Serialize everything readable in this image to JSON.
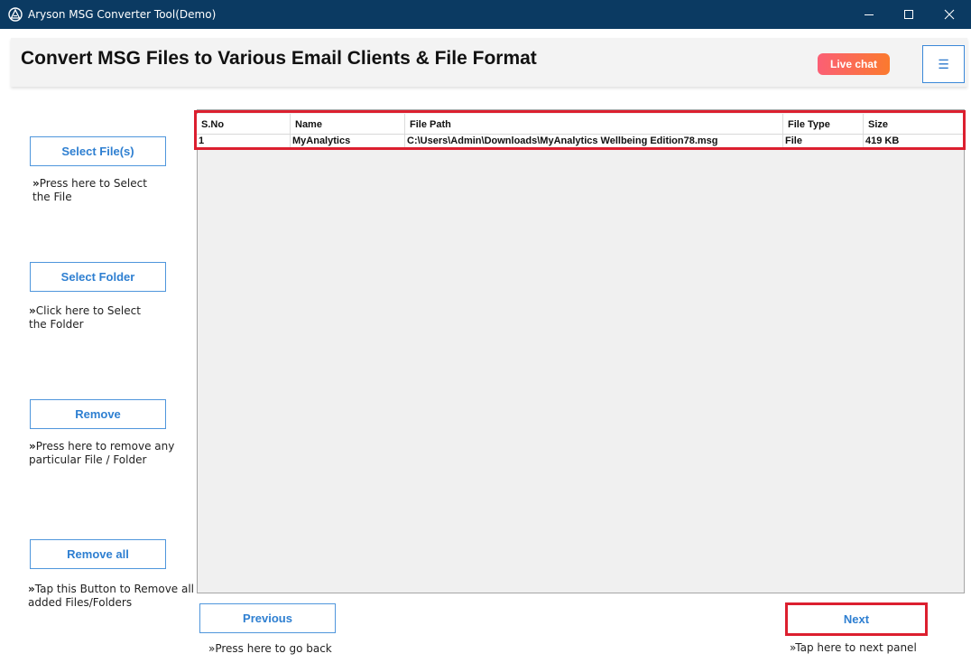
{
  "window": {
    "title": "Aryson MSG Converter Tool(Demo)",
    "titlebar_color": "#0b3a62"
  },
  "header": {
    "headline": "Convert MSG Files to Various Email Clients & File Format",
    "live_chat_label": "Live chat",
    "menu_icon": "☰"
  },
  "sidebar": {
    "select_files": {
      "label": "Select File(s)",
      "hint_mark": "»",
      "hint_line1": "Press here to Select",
      "hint_line2": "the File"
    },
    "select_folder": {
      "label": "Select Folder",
      "hint_mark": "»",
      "hint_line1": "Click here to Select",
      "hint_line2": "the Folder"
    },
    "remove": {
      "label": "Remove",
      "hint_mark": "»",
      "hint_line1": "Press here to remove any",
      "hint_line2": "particular File / Folder"
    },
    "remove_all": {
      "label": "Remove all",
      "hint_mark": "»",
      "hint_line1": "Tap this Button to Remove all",
      "hint_line2": "added Files/Folders"
    }
  },
  "table": {
    "columns": [
      "S.No",
      "Name",
      "File Path",
      "File Type",
      "Size"
    ],
    "rows": [
      [
        "1",
        "MyAnalytics",
        "C:\\Users\\Admin\\Downloads\\MyAnalytics Wellbeing Edition78.msg",
        "File",
        "419 KB"
      ]
    ]
  },
  "footer": {
    "previous_label": "Previous",
    "previous_hint": "»Press here to go back",
    "next_label": "Next",
    "next_hint": "»Tap here to next panel"
  },
  "colors": {
    "accent_blue": "#2e7fd1",
    "highlight_red": "#dc1f2f"
  }
}
